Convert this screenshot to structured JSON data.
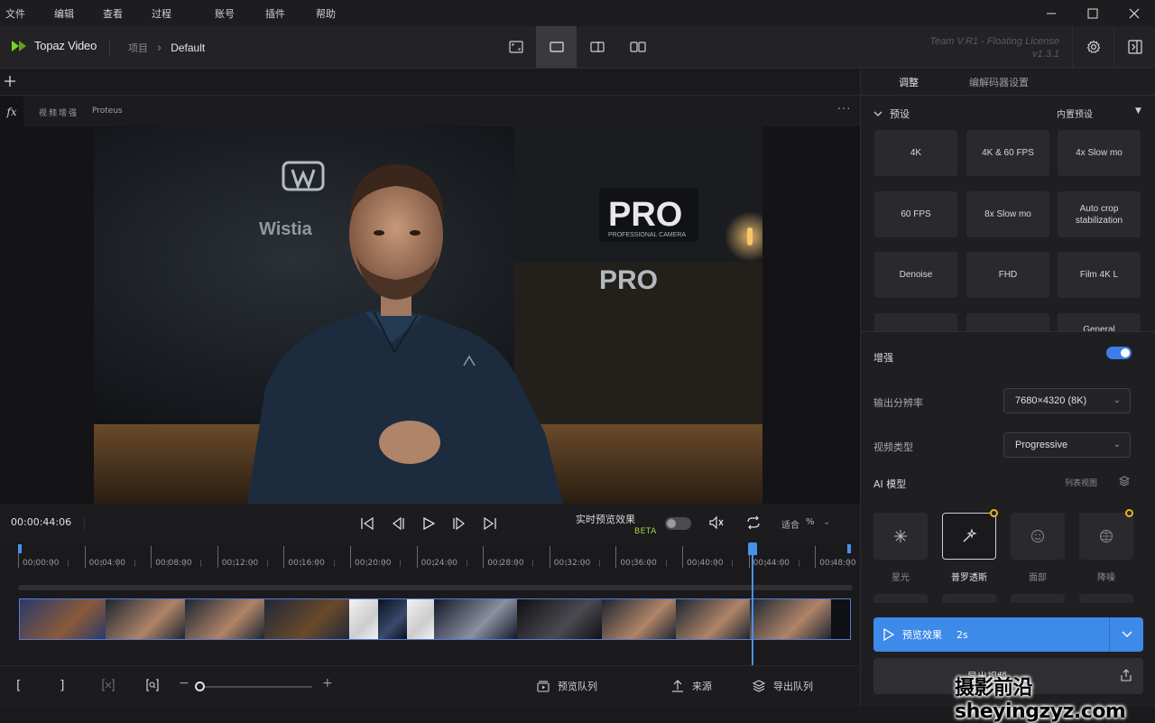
{
  "menubar": {
    "items": [
      "文件",
      "编辑",
      "查看",
      "过程",
      "账号",
      "插件",
      "帮助"
    ]
  },
  "header": {
    "app_name": "Topaz Video",
    "breadcrumb_project": "项目",
    "breadcrumb_current": "Default",
    "license_line1": "Team V.R1 - Floating License",
    "license_line2": "v1.3.1"
  },
  "filter": {
    "name": "视频增强",
    "model": "Proteus",
    "more": "···"
  },
  "playback": {
    "timecode": "00:00:44:06",
    "realtime_label": "实时预览效果",
    "beta": "BETA",
    "zoom_fit": "适合",
    "zoom_unit": "%"
  },
  "timeline": {
    "ticks": [
      "00:00:00",
      "00:04:00",
      "00:08:00",
      "00:12:00",
      "00:16:00",
      "00:20:00",
      "00:24:00",
      "00:28:00",
      "00:32:00",
      "00:36:00",
      "00:40:00",
      "00:44:00",
      "00:48:00"
    ]
  },
  "bottombar": {
    "queue_preview": "预览队列",
    "source": "来源",
    "export_queue": "导出队列"
  },
  "panel": {
    "tab_adjust": "调整",
    "tab_codec": "编解码器设置",
    "presets_label": "预设",
    "presets_dropdown": "内置预设",
    "presets": [
      "4K",
      "4K & 60 FPS",
      "4x Slow mo",
      "60 FPS",
      "8x Slow mo",
      "Auto crop stabilization",
      "Denoise",
      "FHD",
      "Film 4K L",
      "",
      "",
      "General"
    ],
    "enhance_label": "增强",
    "enhance_on": true,
    "output_res_label": "输出分辨率",
    "output_res_value": "7680×4320 (8K)",
    "video_type_label": "视频类型",
    "video_type_value": "Progressive",
    "ai_model_label": "AI 模型",
    "list_view": "列表视图",
    "models": [
      {
        "name": "星光",
        "icon": "starlight-icon",
        "selected": false,
        "starred": false
      },
      {
        "name": "普罗透斯",
        "icon": "proteus-wand-icon",
        "selected": true,
        "starred": true
      },
      {
        "name": "面部",
        "icon": "face-icon",
        "selected": false,
        "starred": false
      },
      {
        "name": "降噪",
        "icon": "denoise-icon",
        "selected": false,
        "starred": true
      }
    ],
    "preview_label": "预览效果",
    "preview_duration": "2s",
    "export_label": "导出视频"
  },
  "watermark": "摄影前沿 sheyingzyz.com",
  "colors": {
    "accent": "#3d8ae8",
    "beta": "#9fd24a",
    "star": "#e6b820",
    "logo_green": "#7ed321"
  }
}
